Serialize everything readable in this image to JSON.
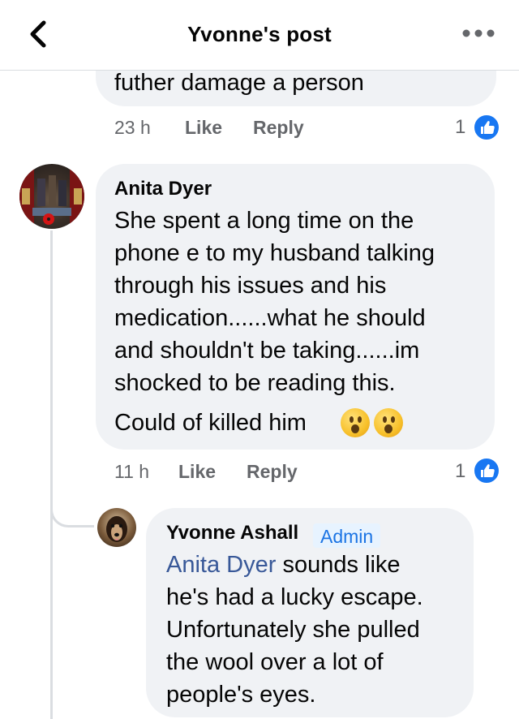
{
  "header": {
    "title": "Yvonne's post",
    "back_icon": "chevron-left-icon",
    "more_icon": "more-horizontal-icon"
  },
  "previous_comment": {
    "text_tail": "futher damage a person",
    "time": "23 h",
    "like_label": "Like",
    "reply_label": "Reply",
    "reaction_count": "1"
  },
  "comment": {
    "author": "Anita Dyer",
    "text": "She spent a long time on the\nphone e to my husband talking\nthrough his issues and his\nmedication......what he should\nand shouldn't be taking......im\nshocked to be reading this.",
    "text_line2": "Could of killed him",
    "emojis": [
      "astonished-face",
      "astonished-face"
    ],
    "time": "11 h",
    "like_label": "Like",
    "reply_label": "Reply",
    "reaction_count": "1"
  },
  "reply": {
    "author": "Yvonne Ashall",
    "badge": "Admin",
    "mention": "Anita Dyer",
    "text_first_line_rest": " sounds like",
    "text_rest": "he's had a lucky escape.\nUnfortunately she pulled\nthe wool over a lot of\npeople's eyes."
  },
  "colors": {
    "bubble": "#f0f2f5",
    "meta": "#65676b",
    "like_blue": "#1877f2",
    "mention": "#385898",
    "admin_bg": "#e7f3ff",
    "admin_text": "#1b74e4"
  }
}
